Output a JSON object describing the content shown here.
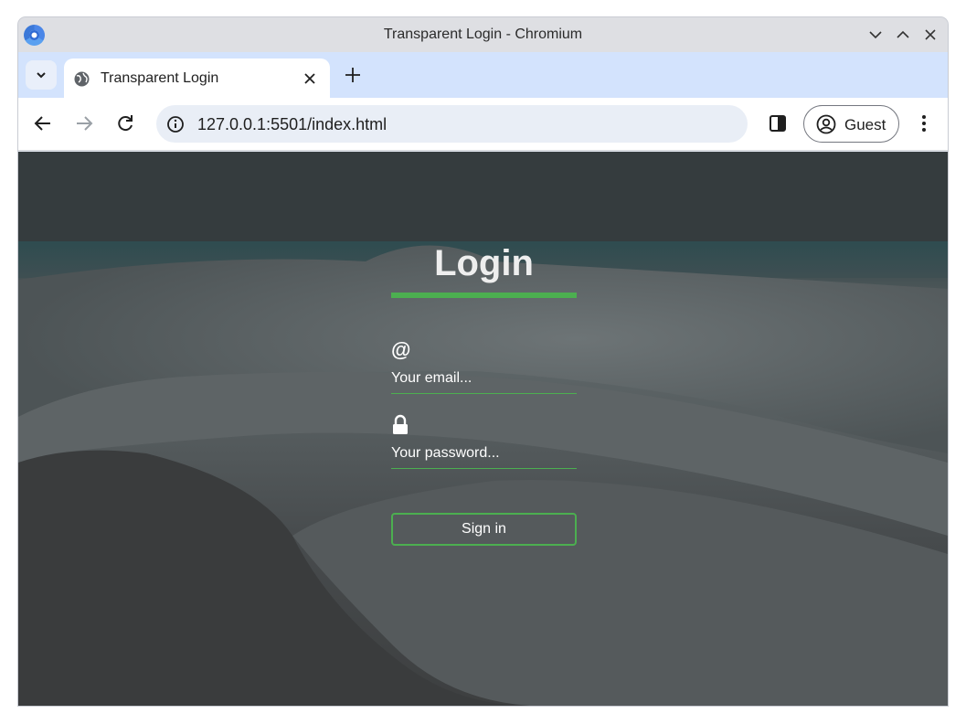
{
  "window": {
    "title": "Transparent Login - Chromium"
  },
  "tabs": [
    {
      "title": "Transparent Login",
      "active": true
    }
  ],
  "toolbar": {
    "url": "127.0.0.1:5501/index.html",
    "profile_label": "Guest"
  },
  "login": {
    "heading": "Login",
    "email_icon": "@",
    "email_placeholder": "Your email...",
    "email_value": "",
    "password_placeholder": "Your password...",
    "password_value": "",
    "signin_label": "Sign in"
  },
  "colors": {
    "accent": "#4caf50",
    "tabstrip": "#d3e3fd",
    "omnibox": "#e9eef6"
  },
  "icons": {
    "email": "at-sign-icon",
    "password": "lock-icon"
  }
}
